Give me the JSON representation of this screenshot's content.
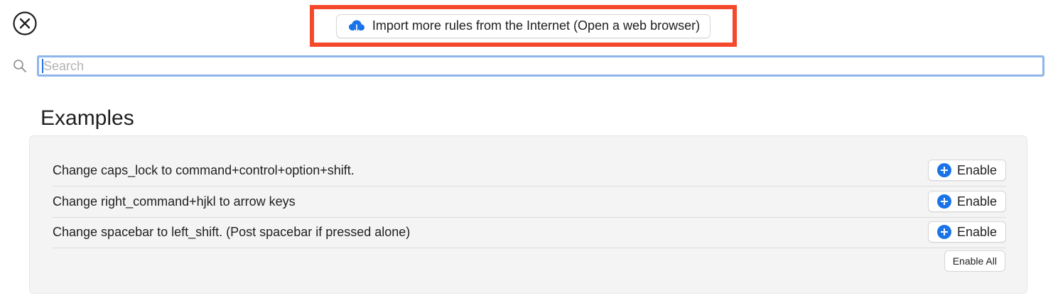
{
  "toolbar": {
    "close_icon": "close-circle-icon",
    "import_button_label": "Import more rules from the Internet (Open a web browser)",
    "import_icon": "cloud-download-icon",
    "highlight_color": "#f5492d"
  },
  "search": {
    "placeholder": "Search",
    "value": "",
    "icon": "search-icon"
  },
  "examples": {
    "title": "Examples",
    "rules": [
      {
        "label": "Change caps_lock to command+control+option+shift.",
        "button_label": "Enable"
      },
      {
        "label": "Change right_command+hjkl to arrow keys",
        "button_label": "Enable"
      },
      {
        "label": "Change spacebar to left_shift. (Post spacebar if pressed alone)",
        "button_label": "Enable"
      }
    ],
    "enable_all_label": "Enable All",
    "accent_color": "#1a73e8"
  }
}
